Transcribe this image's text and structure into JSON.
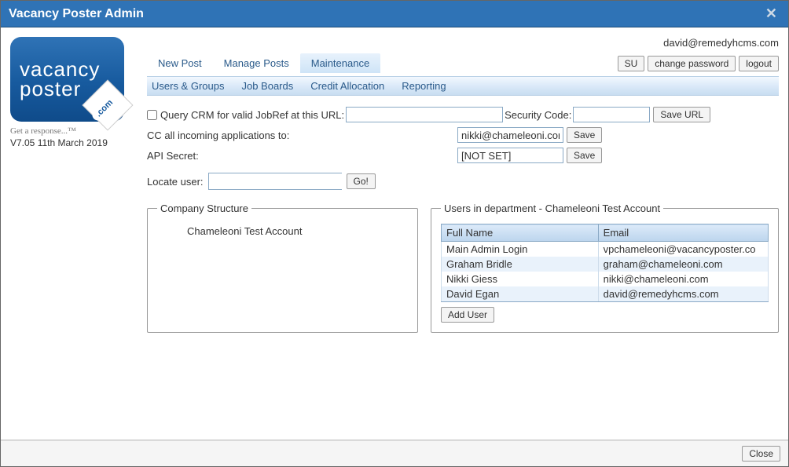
{
  "window": {
    "title": "Vacancy Poster Admin"
  },
  "logo": {
    "line1": "vacancy",
    "line2": "poster",
    "badge": ".com",
    "tagline": "Get a response...™",
    "version": "V7.05 11th March 2019"
  },
  "user_email": "david@remedyhcms.com",
  "tabs": {
    "items": [
      "New Post",
      "Manage Posts",
      "Maintenance"
    ],
    "active_index": 2
  },
  "topbuttons": {
    "su": "SU",
    "change_password": "change password",
    "logout": "logout"
  },
  "subnav": [
    "Users & Groups",
    "Job Boards",
    "Credit Allocation",
    "Reporting"
  ],
  "form": {
    "query_crm_label": "Query CRM for valid JobRef at this URL:",
    "query_crm_checked": false,
    "crm_url": "",
    "security_code_label": "Security Code:",
    "security_code": "",
    "save_url_btn": "Save URL",
    "cc_label": "CC all incoming applications to:",
    "cc_value": "nikki@chameleoni.com",
    "api_label": "API Secret:",
    "api_value": "[NOT SET]",
    "save_btn": "Save",
    "locate_label": "Locate user:",
    "locate_value": "",
    "go_btn": "Go!"
  },
  "company_structure": {
    "legend": "Company Structure",
    "root": "Chameleoni Test Account"
  },
  "users_panel": {
    "legend": "Users in department - Chameleoni Test Account",
    "columns": [
      "Full Name",
      "Email"
    ],
    "rows": [
      {
        "name": "Main Admin Login",
        "email": "vpchameleoni@vacancyposter.co"
      },
      {
        "name": "Graham Bridle",
        "email": "graham@chameleoni.com"
      },
      {
        "name": "Nikki Giess",
        "email": "nikki@chameleoni.com"
      },
      {
        "name": "David Egan",
        "email": "david@remedyhcms.com"
      }
    ],
    "add_user_btn": "Add User"
  },
  "footer": {
    "close": "Close"
  }
}
